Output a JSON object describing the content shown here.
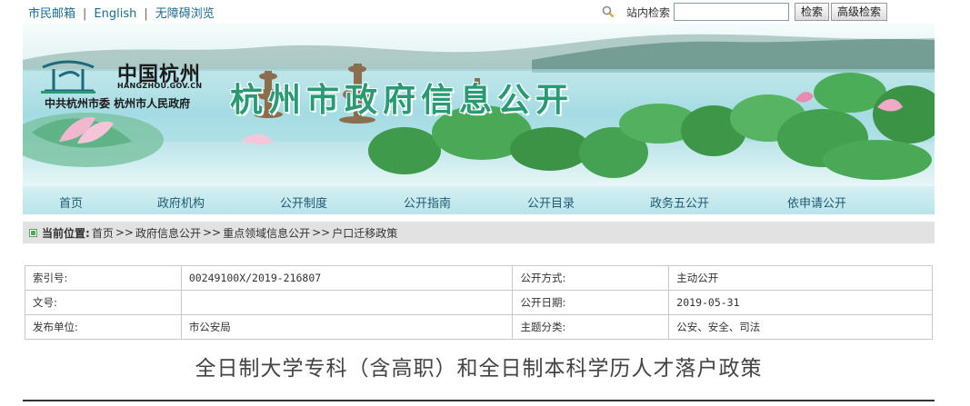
{
  "top_links": [
    "市民邮箱",
    "English",
    "无障碍浏览"
  ],
  "search": {
    "label": "站内检索",
    "value": "",
    "button": "检索",
    "advanced_button": "高级检索"
  },
  "banner": {
    "logo_cn": "中国杭州",
    "logo_en": "HANGZHOU.GOV.CN",
    "logo_sub": "中共杭州市委  杭州市人民政府",
    "title": "杭州市政府信息公开"
  },
  "nav": [
    "首页",
    "政府机构",
    "公开制度",
    "公开指南",
    "公开目录",
    "政务五公开",
    "依申请公开"
  ],
  "breadcrumb": {
    "label": "当前位置:",
    "items": [
      "首页",
      "政府信息公开",
      "重点领域信息公开",
      "户口迁移政策"
    ],
    "sep": ">>"
  },
  "info": {
    "index_label": "索引号:",
    "index_value": "00249100X/2019-216807",
    "mode_label": "公开方式:",
    "mode_value": "主动公开",
    "doc_no_label": "文号:",
    "doc_no_value": "",
    "date_label": "公开日期:",
    "date_value": "2019-05-31",
    "publisher_label": "发布单位:",
    "publisher_value": "市公安局",
    "topic_label": "主题分类:",
    "topic_value": "公安、安全、司法"
  },
  "document_title": "全日制大学专科（含高职）和全日制本科学历人才落户政策",
  "colors": {
    "accent": "#1d6b8e",
    "title_green": "#2a9a74",
    "nav_bg": "#c6e9ee"
  }
}
